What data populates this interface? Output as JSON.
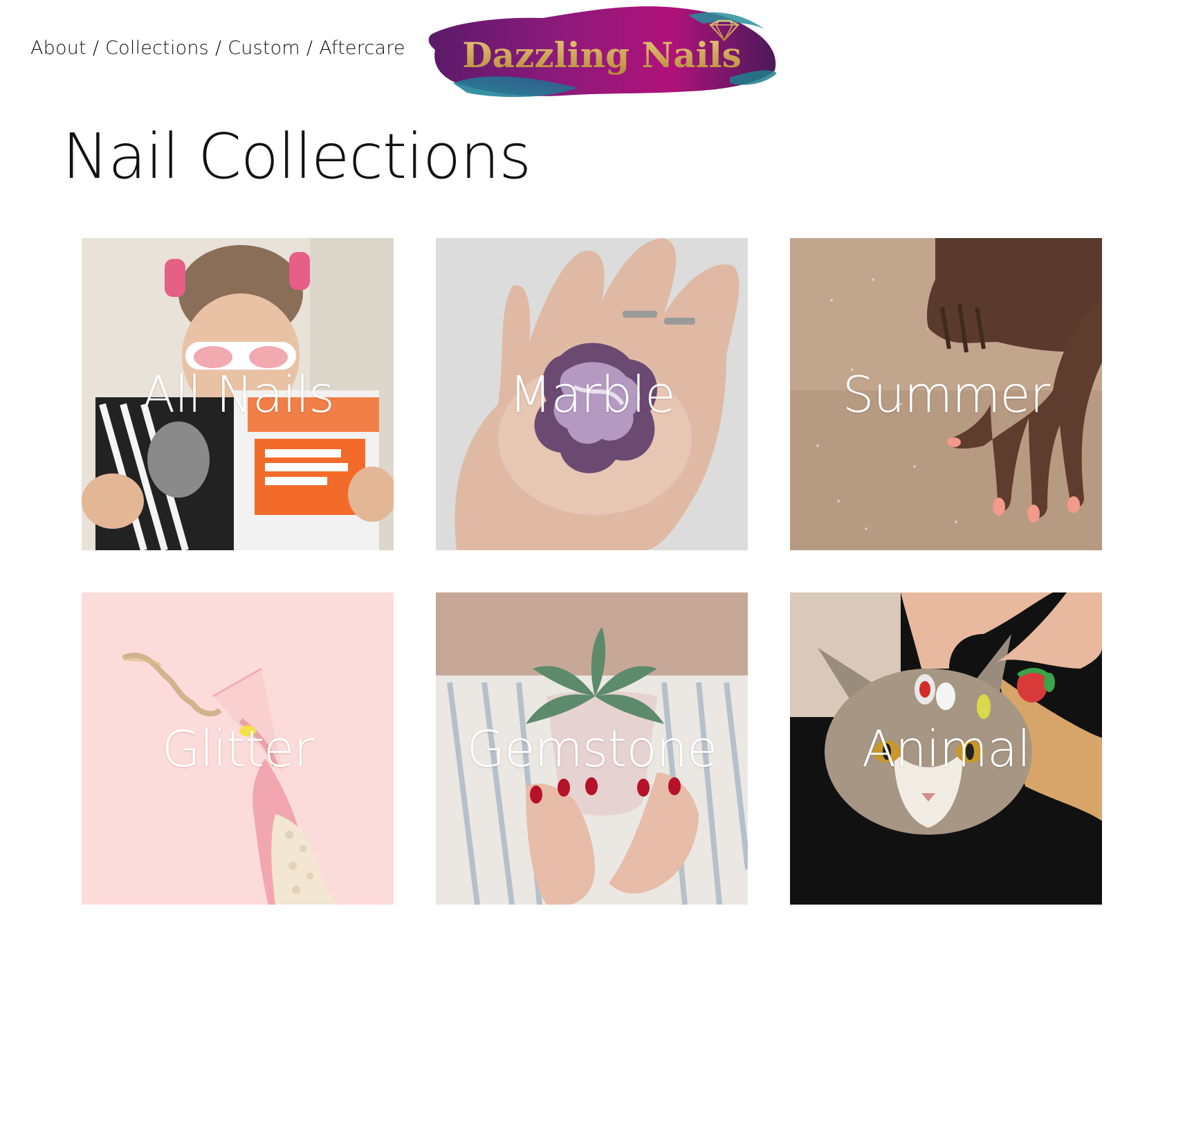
{
  "nav": {
    "items": [
      {
        "label": "About"
      },
      {
        "label": "Collections"
      },
      {
        "label": "Custom"
      },
      {
        "label": "Aftercare"
      }
    ],
    "separator": "/"
  },
  "logo": {
    "text": "Dazzling Nails",
    "icon": "diamond-icon",
    "colors": {
      "gold": "#c9a24a",
      "purple": "#7a1a70",
      "teal": "#1f7f8c",
      "magenta": "#b0127a"
    }
  },
  "page": {
    "title": "Nail Collections"
  },
  "collections": [
    {
      "label": "All Nails",
      "image": "woman-with-magazine"
    },
    {
      "label": "Marble",
      "image": "hand-holding-purple-cookie"
    },
    {
      "label": "Summer",
      "image": "hands-on-sand"
    },
    {
      "label": "Glitter",
      "image": "hand-with-glitter-glass"
    },
    {
      "label": "Gemstone",
      "image": "hands-holding-succulent-pot"
    },
    {
      "label": "Animal",
      "image": "hand-petting-cat"
    }
  ]
}
